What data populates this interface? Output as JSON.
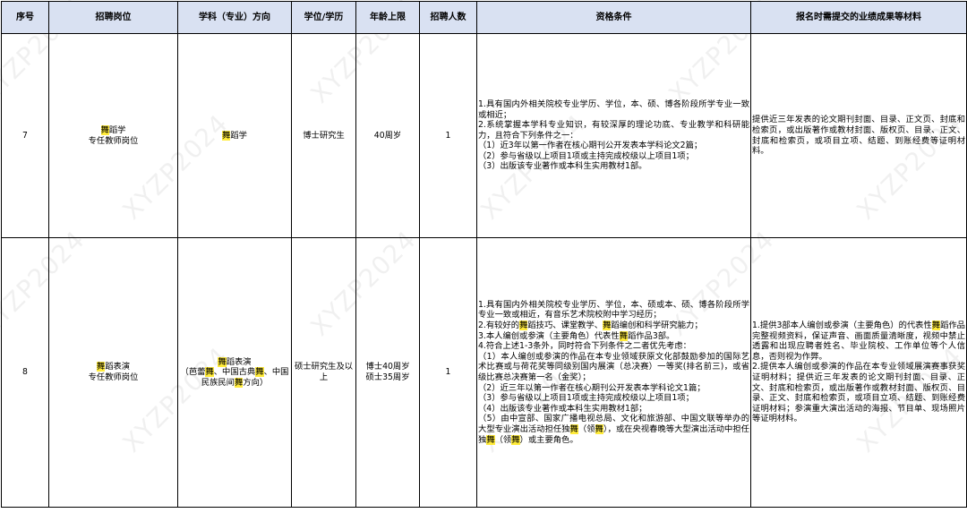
{
  "headers": {
    "seq": "序号",
    "position": "招聘岗位",
    "discipline": "学科（专业）方向",
    "degree": "学位/学历",
    "age": "年龄上限",
    "count": "招聘人数",
    "qualifications": "资格条件",
    "materials": "报名时需提交的业绩成果等材料"
  },
  "watermark": "XYZP2024",
  "rows": [
    {
      "seq": "7",
      "position": [
        "舞蹈学",
        "专任教师岗位"
      ],
      "discipline": [
        "舞蹈学"
      ],
      "degree": "博士研究生",
      "age": [
        "40周岁"
      ],
      "count": "1",
      "qualifications": [
        "1.具有国内外相关院校专业学历、学位，本、硕、博各阶段所学专业一致或相近；",
        "2.系统掌握本学科专业知识，有较深厚的理论功底、专业教学和科研能力，且符合下列条件之一：",
        "（1）近3年以第一作者在核心期刊公开发表本学科论文2篇；",
        "（2）参与省级以上项目1项或主持完成校级以上项目1项；",
        "（3）出版该专业著作或本科生实用教材1部。"
      ],
      "materials": [
        "提供近三年发表的论文期刊封面、目录、正文页、封底和检索页，或出版著作或教材封面、版权页、目录、正文、封底和检索页，或项目立项、结题、到账经费等证明材料。"
      ]
    },
    {
      "seq": "8",
      "position": [
        "舞蹈表演",
        "专任教师岗位"
      ],
      "discipline": [
        "舞蹈表演",
        "（芭蕾舞、中国古典舞、中国民族民间舞方向）"
      ],
      "degree": "硕士研究生及以上",
      "age": [
        "博士40周岁",
        "硕士35周岁"
      ],
      "count": "1",
      "qualifications": [
        "1.具有国内外相关院校专业学历、学位，本、硕或本、硕、博各阶段所学专业一致或相近，有音乐艺术院校附中学习经历；",
        "2.有较好的舞蹈技巧、课堂教学、舞蹈编创和科学研究能力；",
        "3.本人编创或参演（主要角色）代表性舞蹈作品3部。",
        "4.符合上述1-3条外，同时符合下列条件之二者优先考虑：",
        "（1）本人编创或参演的作品在本专业领域获原文化部鼓励参加的国际艺术比赛或与荷花奖等同级别国内展演（总决赛）一等奖(排名前三)，或省级比赛总决赛第一名（金奖）；",
        "（2）近三年以第一作者在核心期刊公开发表本学科论文1篇；",
        "（3）参与省级以上项目1项或主持完成校级以上项目1项；",
        "（4）出版该专业著作或本科生实用教材1部；",
        "（5）由中宣部、国家广播电视总局、文化和旅游部、中国文联等举办的大型专业演出活动担任独舞（领舞），或在央视春晚等大型演出活动中担任独舞（领舞）或主要角色。"
      ],
      "materials": [
        "1.提供3部本人编创或参演（主要角色）的代表性舞蹈作品完整视频资料，保证声音、画面质量清晰度，视频中禁止透露和出现应聘者姓名、毕业院校、工作单位等个人信息，否则视为作弊。",
        "2.提供本人编创或参演的作品在本专业领域展演赛事获奖证明材料；提供近三年发表的论文期刊封面、目录、正文、封底和检索页，或出版著作或教材封面、版权页、目录、正文、封底和检索页，或项目立项、结题、到账经费证明材料；参演重大演出活动的海报、节目单、现场照片等证明材料。"
      ]
    }
  ]
}
